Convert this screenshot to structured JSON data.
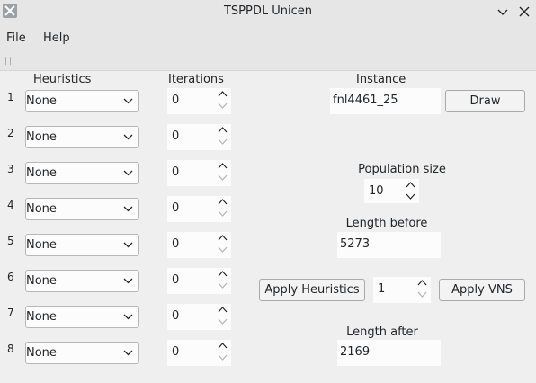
{
  "window": {
    "title": "TSPPDL Unicen"
  },
  "menu": {
    "file": "File",
    "help": "Help"
  },
  "headers": {
    "heuristics": "Heuristics",
    "iterations": "Iterations",
    "instance": "Instance"
  },
  "rows": [
    {
      "num": "1",
      "heuristic": "None",
      "iterations": "0"
    },
    {
      "num": "2",
      "heuristic": "None",
      "iterations": "0"
    },
    {
      "num": "3",
      "heuristic": "None",
      "iterations": "0"
    },
    {
      "num": "4",
      "heuristic": "None",
      "iterations": "0"
    },
    {
      "num": "5",
      "heuristic": "None",
      "iterations": "0"
    },
    {
      "num": "6",
      "heuristic": "None",
      "iterations": "0"
    },
    {
      "num": "7",
      "heuristic": "None",
      "iterations": "0"
    },
    {
      "num": "8",
      "heuristic": "None",
      "iterations": "0"
    }
  ],
  "instance": {
    "value": "fnl4461_25",
    "draw_label": "Draw"
  },
  "population": {
    "label": "Population size",
    "value": "10"
  },
  "length_before": {
    "label": "Length before",
    "value": "5273"
  },
  "apply": {
    "heuristics_label": "Apply Heuristics",
    "count": "1",
    "vns_label": "Apply VNS"
  },
  "length_after": {
    "label": "Length after",
    "value": "2169"
  }
}
